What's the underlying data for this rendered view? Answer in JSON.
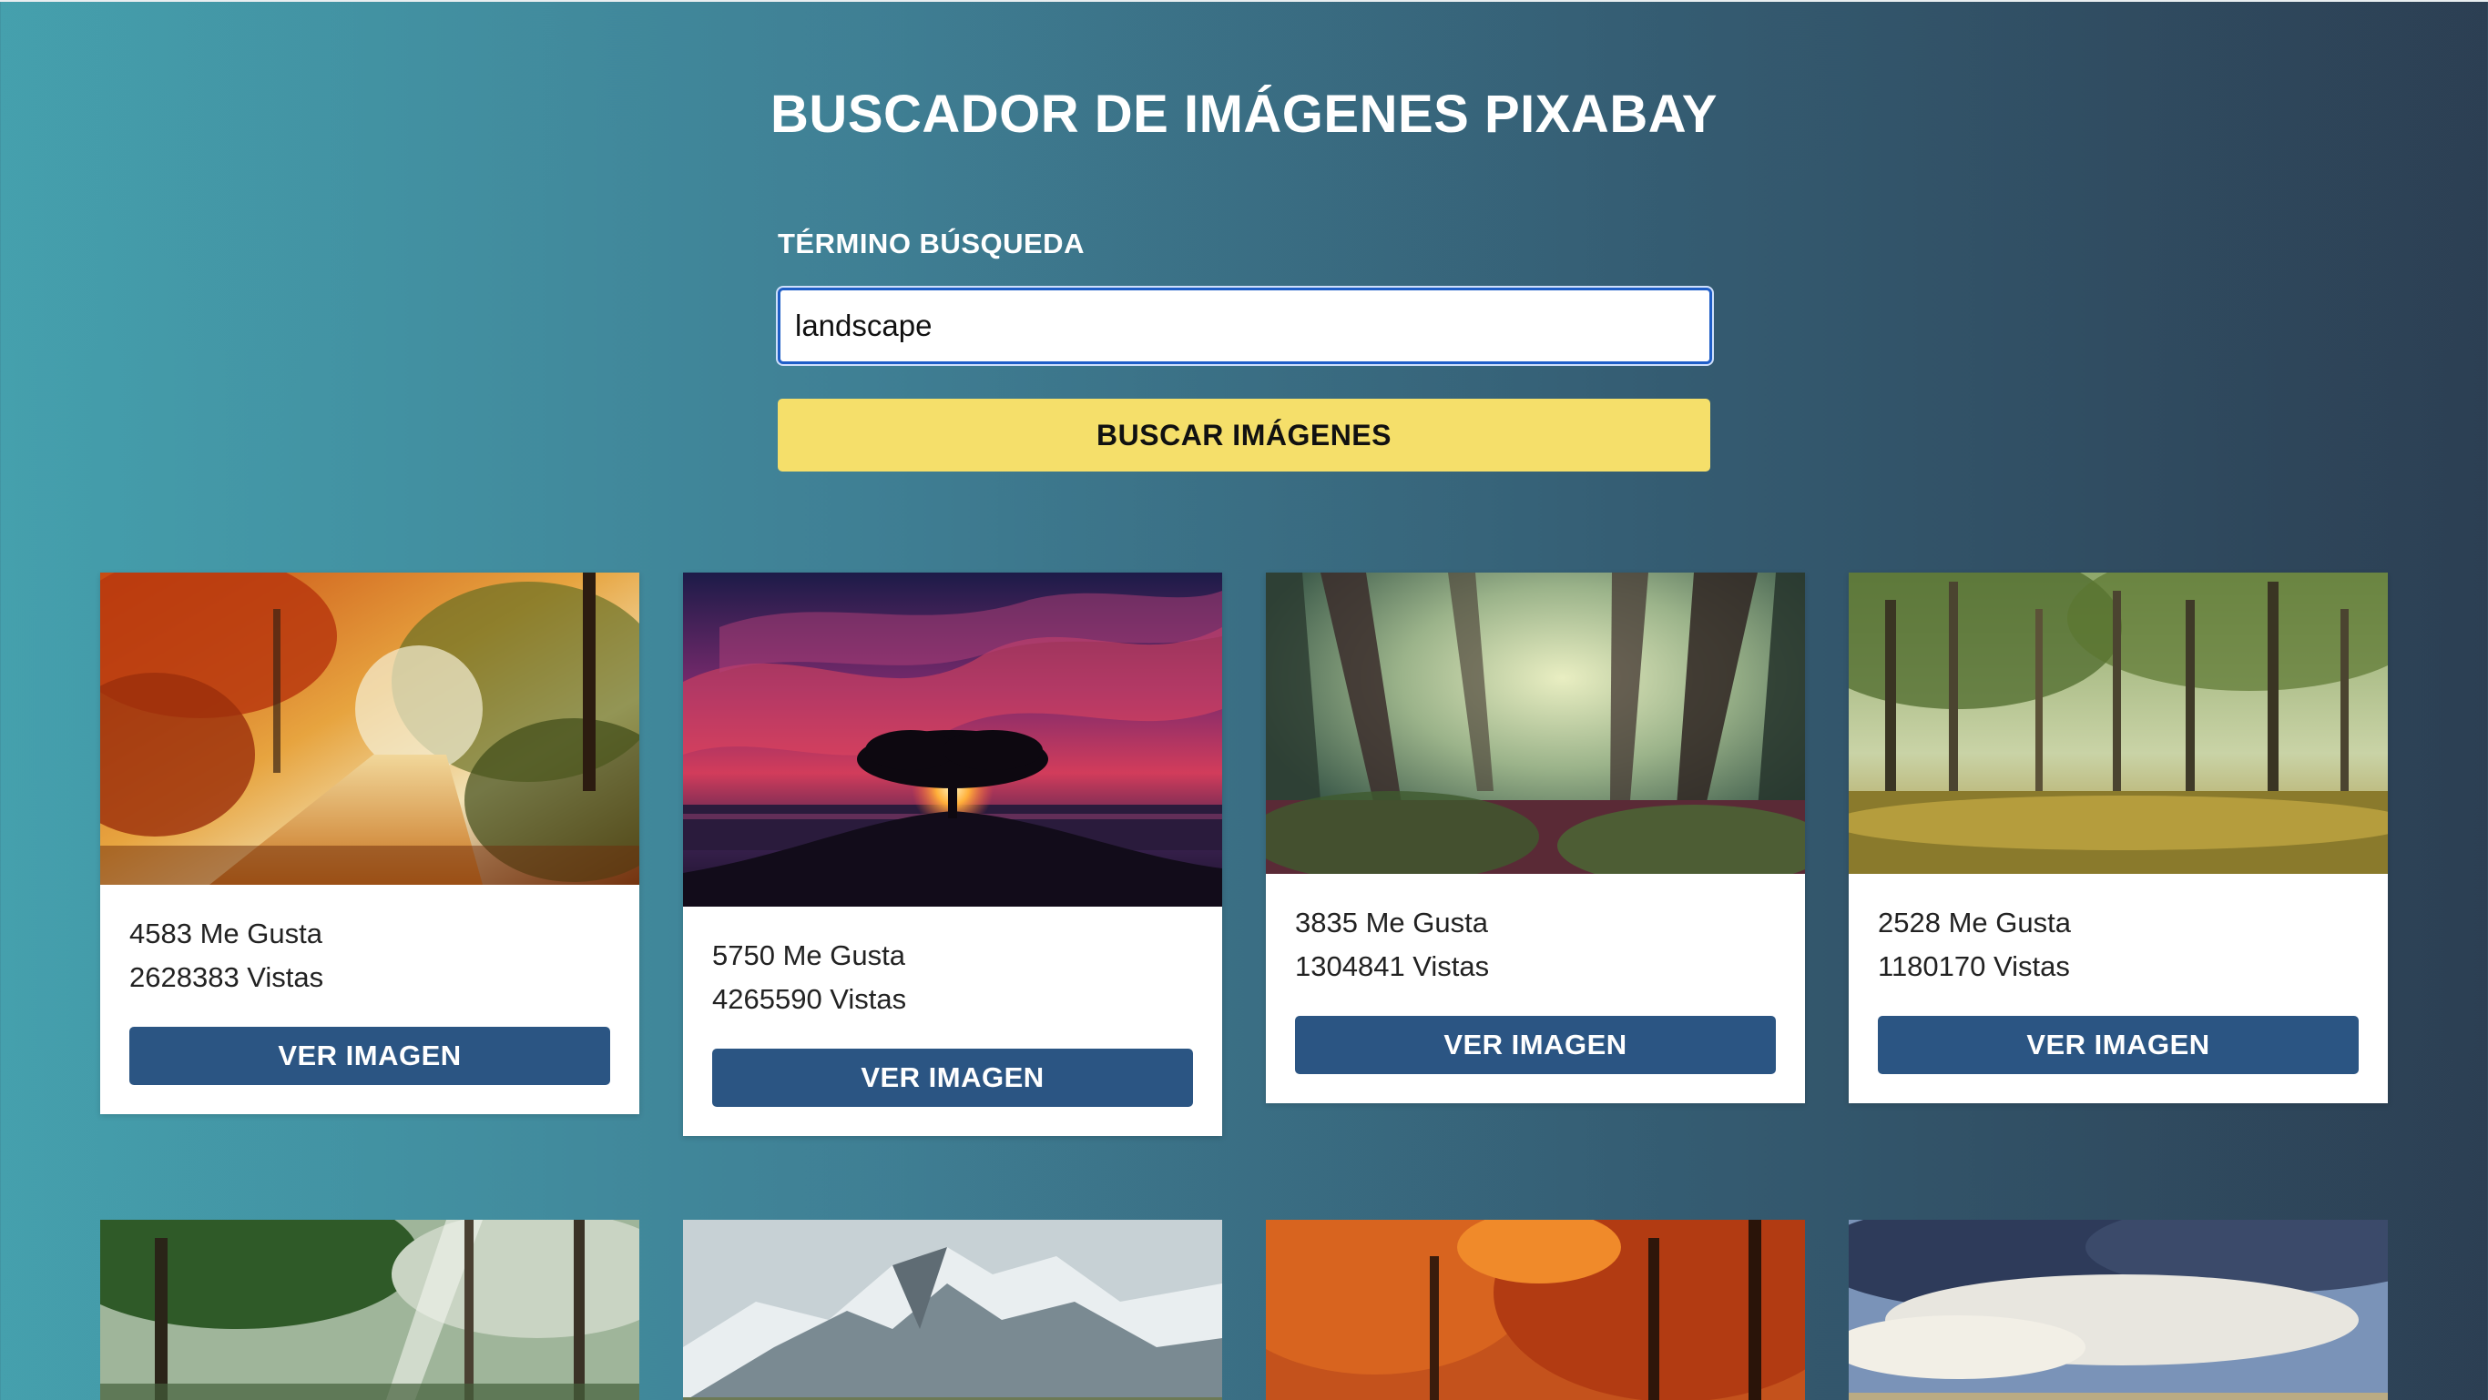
{
  "header": {
    "title": "BUSCADOR DE IMÁGENES PIXABAY"
  },
  "search": {
    "label": "TÉRMINO BÚSQUEDA",
    "value": "landscape",
    "button_label": "BUSCAR IMÁGENES"
  },
  "results": [
    {
      "likes": "4583 Me Gusta",
      "views": "2628383 Vistas",
      "button": "VER IMAGEN",
      "subject": "autumn forest path"
    },
    {
      "likes": "5750 Me Gusta",
      "views": "4265590 Vistas",
      "button": "VER IMAGEN",
      "subject": "tree at sunset over sea"
    },
    {
      "likes": "3835 Me Gusta",
      "views": "1304841 Vistas",
      "button": "VER IMAGEN",
      "subject": "misty forest"
    },
    {
      "likes": "2528 Me Gusta",
      "views": "1180170 Vistas",
      "button": "VER IMAGEN",
      "subject": "green forest with sunlight"
    }
  ],
  "more_results": [
    {
      "subject": "forest with sun rays"
    },
    {
      "subject": "snowy mountains"
    },
    {
      "subject": "red autumn trees"
    },
    {
      "subject": "cloudy sky landscape"
    }
  ],
  "colors": {
    "search_button": "#f5df6a",
    "view_button": "#2b5583",
    "input_focus": "#1f5ec7"
  }
}
